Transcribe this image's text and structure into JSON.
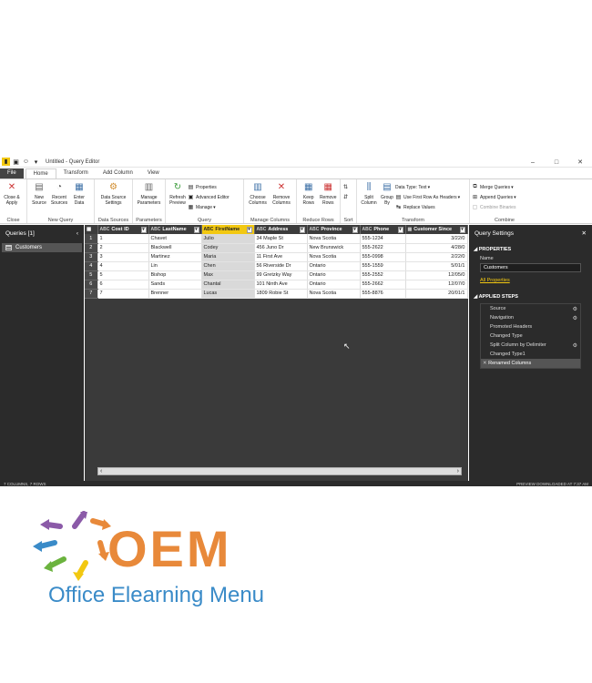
{
  "window": {
    "title": "Untitled - Query Editor",
    "minimize": "–",
    "maximize": "□",
    "close": "✕"
  },
  "tabs": [
    {
      "label": "File"
    },
    {
      "label": "Home"
    },
    {
      "label": "Transform"
    },
    {
      "label": "Add Column"
    },
    {
      "label": "View"
    }
  ],
  "ribbon": {
    "close": {
      "group": "Close",
      "close_apply": "Close & Apply"
    },
    "new_query": {
      "group": "New Query",
      "new_source": "New Source",
      "recent_sources": "Recent Sources",
      "enter_data": "Enter Data"
    },
    "data_sources": {
      "group": "Data Sources",
      "settings": "Data Source Settings"
    },
    "parameters": {
      "group": "Parameters",
      "manage": "Manage Parameters"
    },
    "query": {
      "group": "Query",
      "refresh": "Refresh Preview",
      "properties": "Properties",
      "advanced_editor": "Advanced Editor",
      "manage": "Manage"
    },
    "manage_columns": {
      "group": "Manage Columns",
      "choose": "Choose Columns",
      "remove": "Remove Columns"
    },
    "reduce_rows": {
      "group": "Reduce Rows",
      "keep": "Keep Rows",
      "remove": "Remove Rows"
    },
    "sort": {
      "group": "Sort"
    },
    "transform": {
      "group": "Transform",
      "split": "Split Column",
      "group_by": "Group By",
      "data_type": "Data Type: Text",
      "first_row": "Use First Row As Headers",
      "replace": "Replace Values"
    },
    "combine": {
      "group": "Combine",
      "merge": "Merge Queries",
      "append": "Append Queries",
      "binaries": "Combine Binaries"
    }
  },
  "queries": {
    "title": "Queries [1]",
    "items": [
      {
        "label": "Customers"
      }
    ]
  },
  "grid": {
    "columns": [
      {
        "label": "Cost ID",
        "type": "ABC"
      },
      {
        "label": "LastName",
        "type": "ABC"
      },
      {
        "label": "FirstName",
        "type": "ABC"
      },
      {
        "label": "Address",
        "type": "ABC"
      },
      {
        "label": "Province",
        "type": "ABC"
      },
      {
        "label": "Phone",
        "type": "ABC"
      },
      {
        "label": "Customer Since",
        "type": "▦"
      }
    ],
    "rows": [
      {
        "n": "1",
        "c": [
          "1",
          "Chavet",
          "Julio",
          "34 Maple St",
          "Nova Scotia",
          "555-1234",
          "3/22/0"
        ]
      },
      {
        "n": "2",
        "c": [
          "2",
          "Blackwell",
          "Codey",
          "456 Juno Dr",
          "New Brunswick",
          "555-2622",
          "4/28/0"
        ]
      },
      {
        "n": "3",
        "c": [
          "3",
          "Martinez",
          "Maria",
          "11 First Ave",
          "Nova Scotia",
          "555-0998",
          "2/22/0"
        ]
      },
      {
        "n": "4",
        "c": [
          "4",
          "Lin",
          "Chen",
          "56 Riverside Dr",
          "Ontario",
          "555-1559",
          "5/01/1"
        ]
      },
      {
        "n": "5",
        "c": [
          "5",
          "Bishop",
          "Max",
          "99 Gretzky Way",
          "Ontario",
          "555-2552",
          "12/05/0"
        ]
      },
      {
        "n": "6",
        "c": [
          "6",
          "Sands",
          "Chantal",
          "101 Ninth Ave",
          "Ontario",
          "555-2662",
          "12/07/0"
        ]
      },
      {
        "n": "7",
        "c": [
          "7",
          "Brenner",
          "Lucas",
          "1809 Robie St",
          "Nova Scotia",
          "555-8876",
          "20/01/1"
        ]
      }
    ]
  },
  "settings": {
    "title": "Query Settings",
    "properties_title": "PROPERTIES",
    "name_label": "Name",
    "name_value": "Customers",
    "all_properties": "All Properties",
    "steps_title": "APPLIED STEPS",
    "steps": [
      {
        "label": "Source",
        "gear": true
      },
      {
        "label": "Navigation",
        "gear": true
      },
      {
        "label": "Promoted Headers",
        "gear": false
      },
      {
        "label": "Changed Type",
        "gear": false
      },
      {
        "label": "Split Column by Delimiter",
        "gear": true
      },
      {
        "label": "Changed Type1",
        "gear": false
      },
      {
        "label": "Renamed Columns",
        "gear": false
      }
    ]
  },
  "status": {
    "left": "7 COLUMNS, 7 ROWS",
    "right": "PREVIEW DOWNLOADED AT 7:37 AM"
  },
  "logo": {
    "big": "OEM",
    "sub": "Office Elearning Menu",
    "colors": {
      "orange": "#e8893a",
      "blue": "#3a8bc8",
      "green": "#6bb33e",
      "yellow": "#f2c811",
      "purple": "#8b5aa8"
    }
  }
}
